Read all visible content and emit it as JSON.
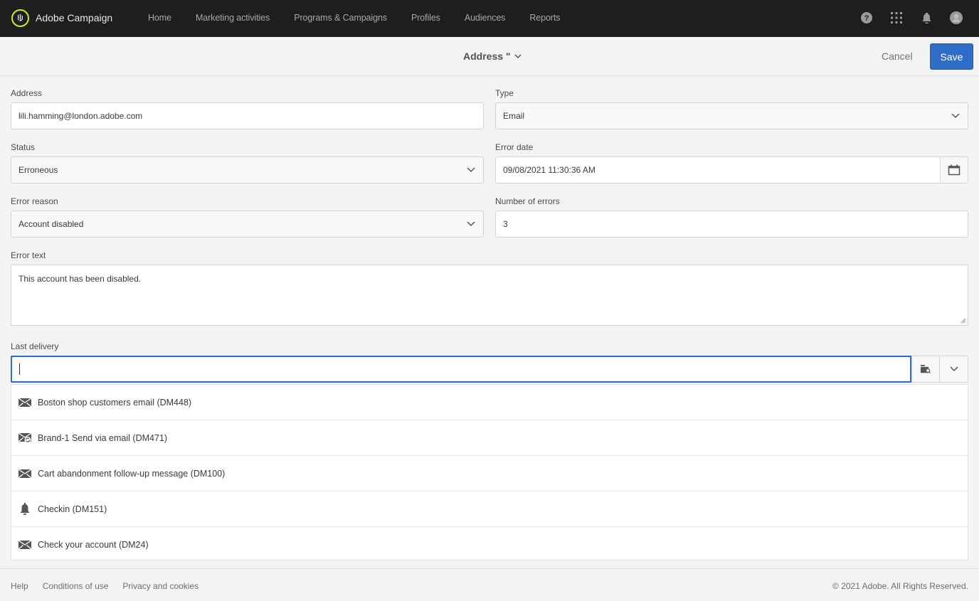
{
  "app": {
    "name": "Adobe Campaign",
    "nav": [
      "Home",
      "Marketing activities",
      "Programs & Campaigns",
      "Profiles",
      "Audiences",
      "Reports"
    ],
    "icons": [
      "help-icon",
      "apps-grid-icon",
      "notification-bell-icon",
      "user-avatar-icon"
    ]
  },
  "header": {
    "title": "Address \"",
    "cancel_label": "Cancel",
    "save_label": "Save"
  },
  "form": {
    "address": {
      "label": "Address",
      "value": "lili.hamming@london.adobe.com"
    },
    "type": {
      "label": "Type",
      "value": "Email"
    },
    "status": {
      "label": "Status",
      "value": "Erroneous"
    },
    "error_date": {
      "label": "Error date",
      "value": "09/08/2021 11:30:36 AM"
    },
    "error_reason": {
      "label": "Error reason",
      "value": "Account disabled"
    },
    "number_of_errors": {
      "label": "Number of errors",
      "value": "3"
    },
    "error_text": {
      "label": "Error text",
      "value": "This account has been disabled."
    },
    "last_delivery": {
      "label": "Last delivery",
      "value": "",
      "options": [
        {
          "icon": "email-icon",
          "label": "Boston shop customers email (DM448)"
        },
        {
          "icon": "email-recurring-icon",
          "label": "Brand-1 Send via email (DM471)"
        },
        {
          "icon": "email-icon",
          "label": "Cart abandonment follow-up message (DM100)"
        },
        {
          "icon": "push-notification-icon",
          "label": "Checkin (DM151)"
        },
        {
          "icon": "email-icon",
          "label": "Check your account (DM24)"
        }
      ]
    }
  },
  "footer": {
    "links": [
      "Help",
      "Conditions of use",
      "Privacy and cookies"
    ],
    "copyright": "© 2021 Adobe. All Rights Reserved."
  },
  "colors": {
    "accent": "#2d6cc7",
    "topbar": "#1e1e1e",
    "logo_ring": "#d7e62a"
  }
}
